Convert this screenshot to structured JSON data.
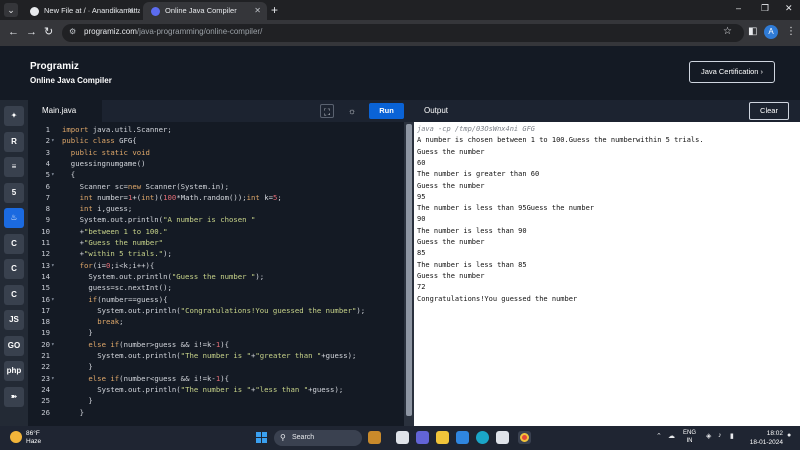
{
  "browser": {
    "tabs": [
      {
        "title": "New File at / · Anandikamatta/",
        "active": false
      },
      {
        "title": "Online Java Compiler",
        "active": true
      }
    ],
    "new_tab": "+",
    "url_domain": "programiz.com",
    "url_path": "/java-programming/online-compiler/",
    "profile_initial": "A"
  },
  "site": {
    "logo": "Programiz",
    "subtitle": "Online Java Compiler",
    "cert_button": "Java Certification ›"
  },
  "rail": {
    "items": [
      {
        "icon": "python-icon",
        "glyph": "✦",
        "active": false
      },
      {
        "icon": "r-icon",
        "glyph": "R",
        "active": false
      },
      {
        "icon": "sql-icon",
        "glyph": "≡",
        "active": false
      },
      {
        "icon": "html-icon",
        "glyph": "5",
        "active": false
      },
      {
        "icon": "java-icon",
        "glyph": "♨",
        "active": true
      },
      {
        "icon": "c-icon",
        "glyph": "C",
        "active": false
      },
      {
        "icon": "cpp-icon",
        "glyph": "C",
        "active": false
      },
      {
        "icon": "csharp-icon",
        "glyph": "C",
        "active": false
      },
      {
        "icon": "js-icon",
        "glyph": "JS",
        "active": false
      },
      {
        "icon": "go-icon",
        "glyph": "GO",
        "active": false
      },
      {
        "icon": "php-icon",
        "glyph": "php",
        "active": false
      },
      {
        "icon": "swift-icon",
        "glyph": "➽",
        "active": false
      }
    ]
  },
  "editor": {
    "file_tab": "Main.java",
    "run_label": "Run",
    "lines": [
      {
        "n": "1",
        "fold": "",
        "indent": 0,
        "code": "import java.util.Scanner;"
      },
      {
        "n": "2",
        "fold": "▾",
        "indent": 0,
        "code": "public class GFG{"
      },
      {
        "n": "3",
        "fold": "",
        "indent": 2,
        "code": "public static void"
      },
      {
        "n": "4",
        "fold": "",
        "indent": 2,
        "code": "guessingnumgame()"
      },
      {
        "n": "5",
        "fold": "▾",
        "indent": 2,
        "code": "{"
      },
      {
        "n": "6",
        "fold": "",
        "indent": 4,
        "code": "Scanner sc=new Scanner(System.in);"
      },
      {
        "n": "7",
        "fold": "",
        "indent": 4,
        "code": "int number=1+(int)(100*Math.random());int k=5;"
      },
      {
        "n": "8",
        "fold": "",
        "indent": 4,
        "code": "int i,guess;"
      },
      {
        "n": "9",
        "fold": "",
        "indent": 4,
        "code": "System.out.println(\"A number is chosen \""
      },
      {
        "n": "10",
        "fold": "",
        "indent": 4,
        "code": "+\"between 1 to 100.\""
      },
      {
        "n": "11",
        "fold": "",
        "indent": 4,
        "code": "+\"Guess the number\""
      },
      {
        "n": "12",
        "fold": "",
        "indent": 4,
        "code": "+\"within 5 trials.\");"
      },
      {
        "n": "13",
        "fold": "▾",
        "indent": 4,
        "code": "for(i=0;i<k;i++){"
      },
      {
        "n": "14",
        "fold": "",
        "indent": 6,
        "code": "System.out.println(\"Guess the number \");"
      },
      {
        "n": "15",
        "fold": "",
        "indent": 6,
        "code": "guess=sc.nextInt();"
      },
      {
        "n": "16",
        "fold": "▾",
        "indent": 6,
        "code": "if(number==guess){"
      },
      {
        "n": "17",
        "fold": "",
        "indent": 8,
        "code": "System.out.println(\"Congratulations!You guessed the number\");"
      },
      {
        "n": "18",
        "fold": "",
        "indent": 8,
        "code": "break;"
      },
      {
        "n": "19",
        "fold": "",
        "indent": 6,
        "code": "}"
      },
      {
        "n": "20",
        "fold": "▾",
        "indent": 6,
        "code": "else if(number>guess && i!=k-1){"
      },
      {
        "n": "21",
        "fold": "",
        "indent": 8,
        "code": "System.out.println(\"The number is \"+\"greater than \"+guess);"
      },
      {
        "n": "22",
        "fold": "",
        "indent": 6,
        "code": "}"
      },
      {
        "n": "23",
        "fold": "▾",
        "indent": 6,
        "code": "else if(number<guess && i!=k-1){"
      },
      {
        "n": "24",
        "fold": "",
        "indent": 8,
        "code": "System.out.println(\"The number is \"+\"less than \"+guess);"
      },
      {
        "n": "25",
        "fold": "",
        "indent": 6,
        "code": "}"
      },
      {
        "n": "26",
        "fold": "",
        "indent": 4,
        "code": "}"
      }
    ]
  },
  "output": {
    "title": "Output",
    "clear_label": "Clear",
    "lines": [
      "java -cp /tmp/03OsWnx4ni GFG",
      "A number is chosen between 1 to 100.Guess the numberwithin 5 trials.",
      "Guess the number",
      "60",
      "The number is greater than 60",
      "Guess the number",
      "95",
      "The number is less than 95Guess the number",
      "90",
      "The number is less than 90",
      "Guess the number",
      "85",
      "The number is less than 85",
      "Guess the number",
      "72",
      "Congratulations!You guessed the number"
    ]
  },
  "taskbar": {
    "temperature": "86°F",
    "weather": "Haze",
    "search": "Search",
    "lang_top": "ENG",
    "lang_bottom": "IN",
    "time": "18:02",
    "date": "18-01-2024"
  },
  "colors": {
    "accent": "#0a63d6",
    "editor_bg": "#141a24",
    "string": "#c8d48a",
    "keyword": "#e0a86a",
    "number": "#e06c75"
  }
}
